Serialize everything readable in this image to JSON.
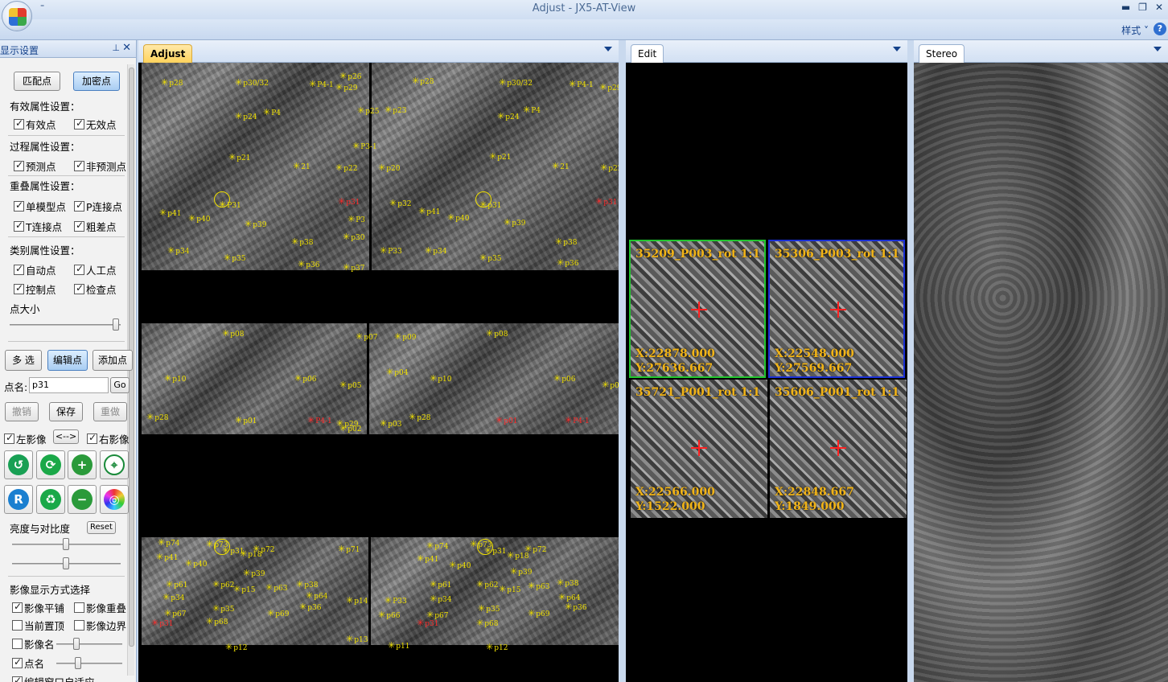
{
  "window": {
    "title": "Adjust - JX5-AT-View",
    "qat_symbol": "⁼",
    "controls": [
      "▬",
      "❐",
      "✕"
    ]
  },
  "ribbon": {
    "style_menu": "样式 ˅",
    "help": "?"
  },
  "left_panel": {
    "title": "显示设置",
    "pin": "⊥",
    "close": "✕",
    "buttons": {
      "match_points": "匹配点",
      "densify_points": "加密点"
    },
    "valid_section": "有效属性设置：",
    "valid_point": "有效点",
    "invalid_point": "无效点",
    "process_section": "过程属性设置：",
    "predicted_point": "预测点",
    "non_predicted_point": "非预测点",
    "overlap_section": "重叠属性设置：",
    "single_model_point": "单模型点",
    "p_tie_point": "P连接点",
    "t_tie_point": "T连接点",
    "gross_error_point": "粗差点",
    "category_section": "类别属性设置：",
    "auto_point": "自动点",
    "manual_point": "人工点",
    "control_point": "控制点",
    "check_point": "检查点",
    "point_size": "点大小",
    "multi_select": "多 选",
    "edit_point": "编辑点",
    "add_point": "添加点",
    "point_name_label": "点名:",
    "point_name_value": "p31",
    "go": "Go",
    "undo": "撤销",
    "save": "保存",
    "redo": "重做",
    "left_image": "左影像",
    "swap": "<-->",
    "right_image": "右影像",
    "brightness_contrast": "亮度与对比度",
    "reset": "Reset",
    "display_mode_section": "影像显示方式选择",
    "image_tile": "影像平铺",
    "image_overlap": "影像重叠",
    "bring_to_top": "当前置顶",
    "image_border": "影像边界",
    "image_name": "影像名",
    "point_name_chk": "点名",
    "edit_window_adapt": "编辑窗口自适应"
  },
  "adjust_view": {
    "tab": "Adjust",
    "points": [
      {
        "label": "p28",
        "c": "y"
      },
      {
        "label": "p26",
        "c": "y"
      },
      {
        "label": "p30/32",
        "c": "y"
      },
      {
        "label": "P4-1",
        "c": "y"
      },
      {
        "label": "p29",
        "c": "y"
      },
      {
        "label": "P4",
        "c": "y"
      },
      {
        "label": "p24",
        "c": "y"
      },
      {
        "label": "p25",
        "c": "y"
      },
      {
        "label": "P3-1",
        "c": "y"
      },
      {
        "label": "p21",
        "c": "y"
      },
      {
        "label": "21",
        "c": "y"
      },
      {
        "label": "p22",
        "c": "y"
      },
      {
        "label": "P31",
        "c": "y"
      },
      {
        "label": "p41",
        "c": "y"
      },
      {
        "label": "p40",
        "c": "y"
      },
      {
        "label": "p39",
        "c": "y"
      },
      {
        "label": "P3",
        "c": "y"
      },
      {
        "label": "p38",
        "c": "y"
      },
      {
        "label": "p30",
        "c": "y"
      },
      {
        "label": "p34",
        "c": "y"
      },
      {
        "label": "p35",
        "c": "y"
      },
      {
        "label": "p36",
        "c": "y"
      },
      {
        "label": "p37",
        "c": "y"
      },
      {
        "label": "p31",
        "c": "r"
      },
      {
        "label": "p28",
        "c": "y"
      },
      {
        "label": "p30/32",
        "c": "y"
      },
      {
        "label": "P4-1",
        "c": "y"
      },
      {
        "label": "p29",
        "c": "y"
      },
      {
        "label": "p23",
        "c": "y"
      },
      {
        "label": "p24",
        "c": "y"
      },
      {
        "label": "P4",
        "c": "y"
      },
      {
        "label": "p21",
        "c": "y"
      },
      {
        "label": "p20",
        "c": "y"
      },
      {
        "label": "21",
        "c": "y"
      },
      {
        "label": "p22",
        "c": "y"
      },
      {
        "label": "p32",
        "c": "y"
      },
      {
        "label": "p31",
        "c": "y"
      },
      {
        "label": "p41",
        "c": "y"
      },
      {
        "label": "p40",
        "c": "y"
      },
      {
        "label": "p39",
        "c": "y"
      },
      {
        "label": "p38",
        "c": "y"
      },
      {
        "label": "P33",
        "c": "y"
      },
      {
        "label": "p34",
        "c": "y"
      },
      {
        "label": "p35",
        "c": "y"
      },
      {
        "label": "p36",
        "c": "y"
      },
      {
        "label": "p31",
        "c": "r"
      },
      {
        "label": "p08",
        "c": "y"
      },
      {
        "label": "p07",
        "c": "y"
      },
      {
        "label": "p10",
        "c": "y"
      },
      {
        "label": "p06",
        "c": "y"
      },
      {
        "label": "p05",
        "c": "y"
      },
      {
        "label": "p28",
        "c": "y"
      },
      {
        "label": "p01",
        "c": "y"
      },
      {
        "label": "P4-1",
        "c": "r"
      },
      {
        "label": "p29",
        "c": "y"
      },
      {
        "label": "p02",
        "c": "y"
      },
      {
        "label": "p09",
        "c": "y"
      },
      {
        "label": "p08",
        "c": "y"
      },
      {
        "label": "p04",
        "c": "y"
      },
      {
        "label": "p10",
        "c": "y"
      },
      {
        "label": "p06",
        "c": "y"
      },
      {
        "label": "p03",
        "c": "y"
      },
      {
        "label": "p28",
        "c": "y"
      },
      {
        "label": "p01",
        "c": "r"
      },
      {
        "label": "P4-1",
        "c": "r"
      },
      {
        "label": "p05",
        "c": "y"
      },
      {
        "label": "p74",
        "c": "y"
      },
      {
        "label": "p73",
        "c": "y"
      },
      {
        "label": "p41",
        "c": "y"
      },
      {
        "label": "p31",
        "c": "y"
      },
      {
        "label": "p18",
        "c": "y"
      },
      {
        "label": "p72",
        "c": "y"
      },
      {
        "label": "p40",
        "c": "y"
      },
      {
        "label": "p39",
        "c": "y"
      },
      {
        "label": "p71",
        "c": "y"
      },
      {
        "label": "p61",
        "c": "y"
      },
      {
        "label": "p62",
        "c": "y"
      },
      {
        "label": "p15",
        "c": "y"
      },
      {
        "label": "p63",
        "c": "y"
      },
      {
        "label": "p38",
        "c": "y"
      },
      {
        "label": "p34",
        "c": "y"
      },
      {
        "label": "p64",
        "c": "y"
      },
      {
        "label": "p35",
        "c": "y"
      },
      {
        "label": "p36",
        "c": "y"
      },
      {
        "label": "p67",
        "c": "y"
      },
      {
        "label": "p68",
        "c": "y"
      },
      {
        "label": "p69",
        "c": "y"
      },
      {
        "label": "p14",
        "c": "y"
      },
      {
        "label": "p13",
        "c": "y"
      },
      {
        "label": "p12",
        "c": "y"
      },
      {
        "label": "p31",
        "c": "r"
      },
      {
        "label": "p74",
        "c": "y"
      },
      {
        "label": "p73",
        "c": "y"
      },
      {
        "label": "p41",
        "c": "y"
      },
      {
        "label": "p31",
        "c": "y"
      },
      {
        "label": "p18",
        "c": "y"
      },
      {
        "label": "p72",
        "c": "y"
      },
      {
        "label": "p40",
        "c": "y"
      },
      {
        "label": "p39",
        "c": "y"
      },
      {
        "label": "p61",
        "c": "y"
      },
      {
        "label": "p62",
        "c": "y"
      },
      {
        "label": "p15",
        "c": "y"
      },
      {
        "label": "p63",
        "c": "y"
      },
      {
        "label": "p38",
        "c": "y"
      },
      {
        "label": "P33",
        "c": "y"
      },
      {
        "label": "p34",
        "c": "y"
      },
      {
        "label": "p64",
        "c": "y"
      },
      {
        "label": "p35",
        "c": "y"
      },
      {
        "label": "p36",
        "c": "y"
      },
      {
        "label": "p66",
        "c": "y"
      },
      {
        "label": "p67",
        "c": "y"
      },
      {
        "label": "p68",
        "c": "y"
      },
      {
        "label": "p69",
        "c": "y"
      },
      {
        "label": "p11",
        "c": "y"
      },
      {
        "label": "p12",
        "c": "y"
      },
      {
        "label": "p31",
        "c": "r"
      }
    ]
  },
  "edit_view": {
    "tab": "Edit",
    "chips": [
      {
        "name": "35209_P003_rot 1:1",
        "x": "X:22878.000",
        "y": "Y:27636.667",
        "border": "#21c62e"
      },
      {
        "name": "35306_P003_rot 1:1",
        "x": "X:22548.000",
        "y": "Y:27569.667",
        "border": "#1a2fd6"
      },
      {
        "name": "35721_P001_rot 1:1",
        "x": "X:22566.000",
        "y": "Y:1522.000",
        "border": ""
      },
      {
        "name": "35606_P001_rot 1:1",
        "x": "X:22848.667",
        "y": "Y:1849.000",
        "border": ""
      }
    ]
  },
  "stereo_view": {
    "tab": "Stereo"
  }
}
